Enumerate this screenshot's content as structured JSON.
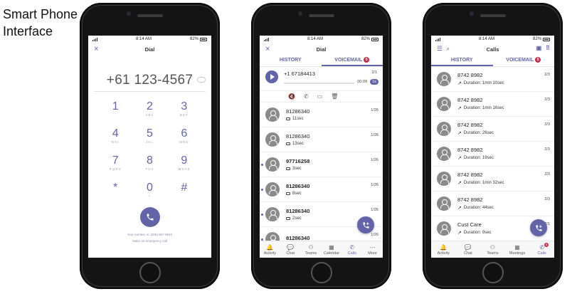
{
  "caption": {
    "line1": "Smart Phone",
    "line2": "Interface"
  },
  "colors": {
    "accent": "#6264a7",
    "badge": "#c4314b"
  },
  "phone1": {
    "status": {
      "time": "8:14 AM",
      "battery": "82%"
    },
    "title": "Dial",
    "close_icon": "×",
    "number": "+61 123-4567",
    "keys": [
      {
        "digit": "1",
        "letters": ""
      },
      {
        "digit": "2",
        "letters": "ABC"
      },
      {
        "digit": "3",
        "letters": "DEF"
      },
      {
        "digit": "4",
        "letters": "GHI"
      },
      {
        "digit": "5",
        "letters": "JKL"
      },
      {
        "digit": "6",
        "letters": "MNO"
      },
      {
        "digit": "7",
        "letters": "PQRS"
      },
      {
        "digit": "8",
        "letters": "TUV"
      },
      {
        "digit": "9",
        "letters": "WXYZ"
      },
      {
        "digit": "*",
        "letters": ""
      },
      {
        "digit": "0",
        "letters": "+"
      },
      {
        "digit": "#",
        "letters": ""
      }
    ],
    "your_number": "Your number is: (555) 867-8543",
    "emergency": "Make an emergency call"
  },
  "phone2": {
    "status": {
      "time": "8:14 AM",
      "battery": "82%"
    },
    "title": "Dial",
    "close_icon": "×",
    "tabs": {
      "history": "HISTORY",
      "voicemail": "VOICEMAIL",
      "voicemail_badge": "5"
    },
    "active_vm": {
      "number": "+1 67184413",
      "count": "2/1",
      "time": "00:09",
      "speed": "1x"
    },
    "actions": [
      "🔇",
      "✆",
      "▭",
      "🗑"
    ],
    "rows": [
      {
        "title": "81286340",
        "sub": "11sec",
        "count": "1/26",
        "unread": false
      },
      {
        "title": "81286340",
        "sub": "13sec",
        "count": "1/26",
        "unread": false
      },
      {
        "title": "97716258",
        "sub": "3sec",
        "count": "1/26",
        "unread": true
      },
      {
        "title": "81286340",
        "sub": "8sec",
        "count": "1/26",
        "unread": true
      },
      {
        "title": "81286340",
        "sub": "2sec",
        "count": "1/26",
        "unread": true
      },
      {
        "title": "81286340",
        "sub": "",
        "count": "1/26",
        "unread": true
      }
    ],
    "nav": [
      {
        "label": "Activity",
        "icon": "🔔",
        "active": false
      },
      {
        "label": "Chat",
        "icon": "💬",
        "active": false
      },
      {
        "label": "Teams",
        "icon": "⚇",
        "active": false
      },
      {
        "label": "Calendar",
        "icon": "▦",
        "active": false
      },
      {
        "label": "Calls",
        "icon": "✆",
        "active": true
      },
      {
        "label": "More",
        "icon": "⋯",
        "active": false
      }
    ]
  },
  "phone3": {
    "status": {
      "time": "8:14 AM",
      "battery": "82%"
    },
    "title": "Calls",
    "tabs": {
      "history": "HISTORY",
      "voicemail": "VOICEMAIL",
      "voicemail_badge": "5"
    },
    "rows": [
      {
        "title": "8742 8982",
        "sub": "Duration: 1min 10sec",
        "count": "2/3"
      },
      {
        "title": "8742 8982",
        "sub": "Duration: 1min 16sec",
        "count": "2/3"
      },
      {
        "title": "8742 8982",
        "sub": "Duration: 26sec",
        "count": "2/3"
      },
      {
        "title": "8742 8982",
        "sub": "Duration: 19sec",
        "count": "2/3"
      },
      {
        "title": "8742 8982",
        "sub": "Duration: 1min 32sec",
        "count": "2/3"
      },
      {
        "title": "8742 8982",
        "sub": "Duration: 44sec",
        "count": "2/3"
      },
      {
        "title": "Cust Care",
        "sub": "Duration: 9sec",
        "count": "2/1"
      }
    ],
    "nav": [
      {
        "label": "Activity",
        "icon": "🔔",
        "active": false
      },
      {
        "label": "Chat",
        "icon": "💬",
        "active": false
      },
      {
        "label": "Teams",
        "icon": "⚇",
        "active": false
      },
      {
        "label": "Meetings",
        "icon": "▦",
        "active": false
      },
      {
        "label": "Calls",
        "icon": "✆",
        "active": true,
        "badge": "5"
      }
    ]
  }
}
